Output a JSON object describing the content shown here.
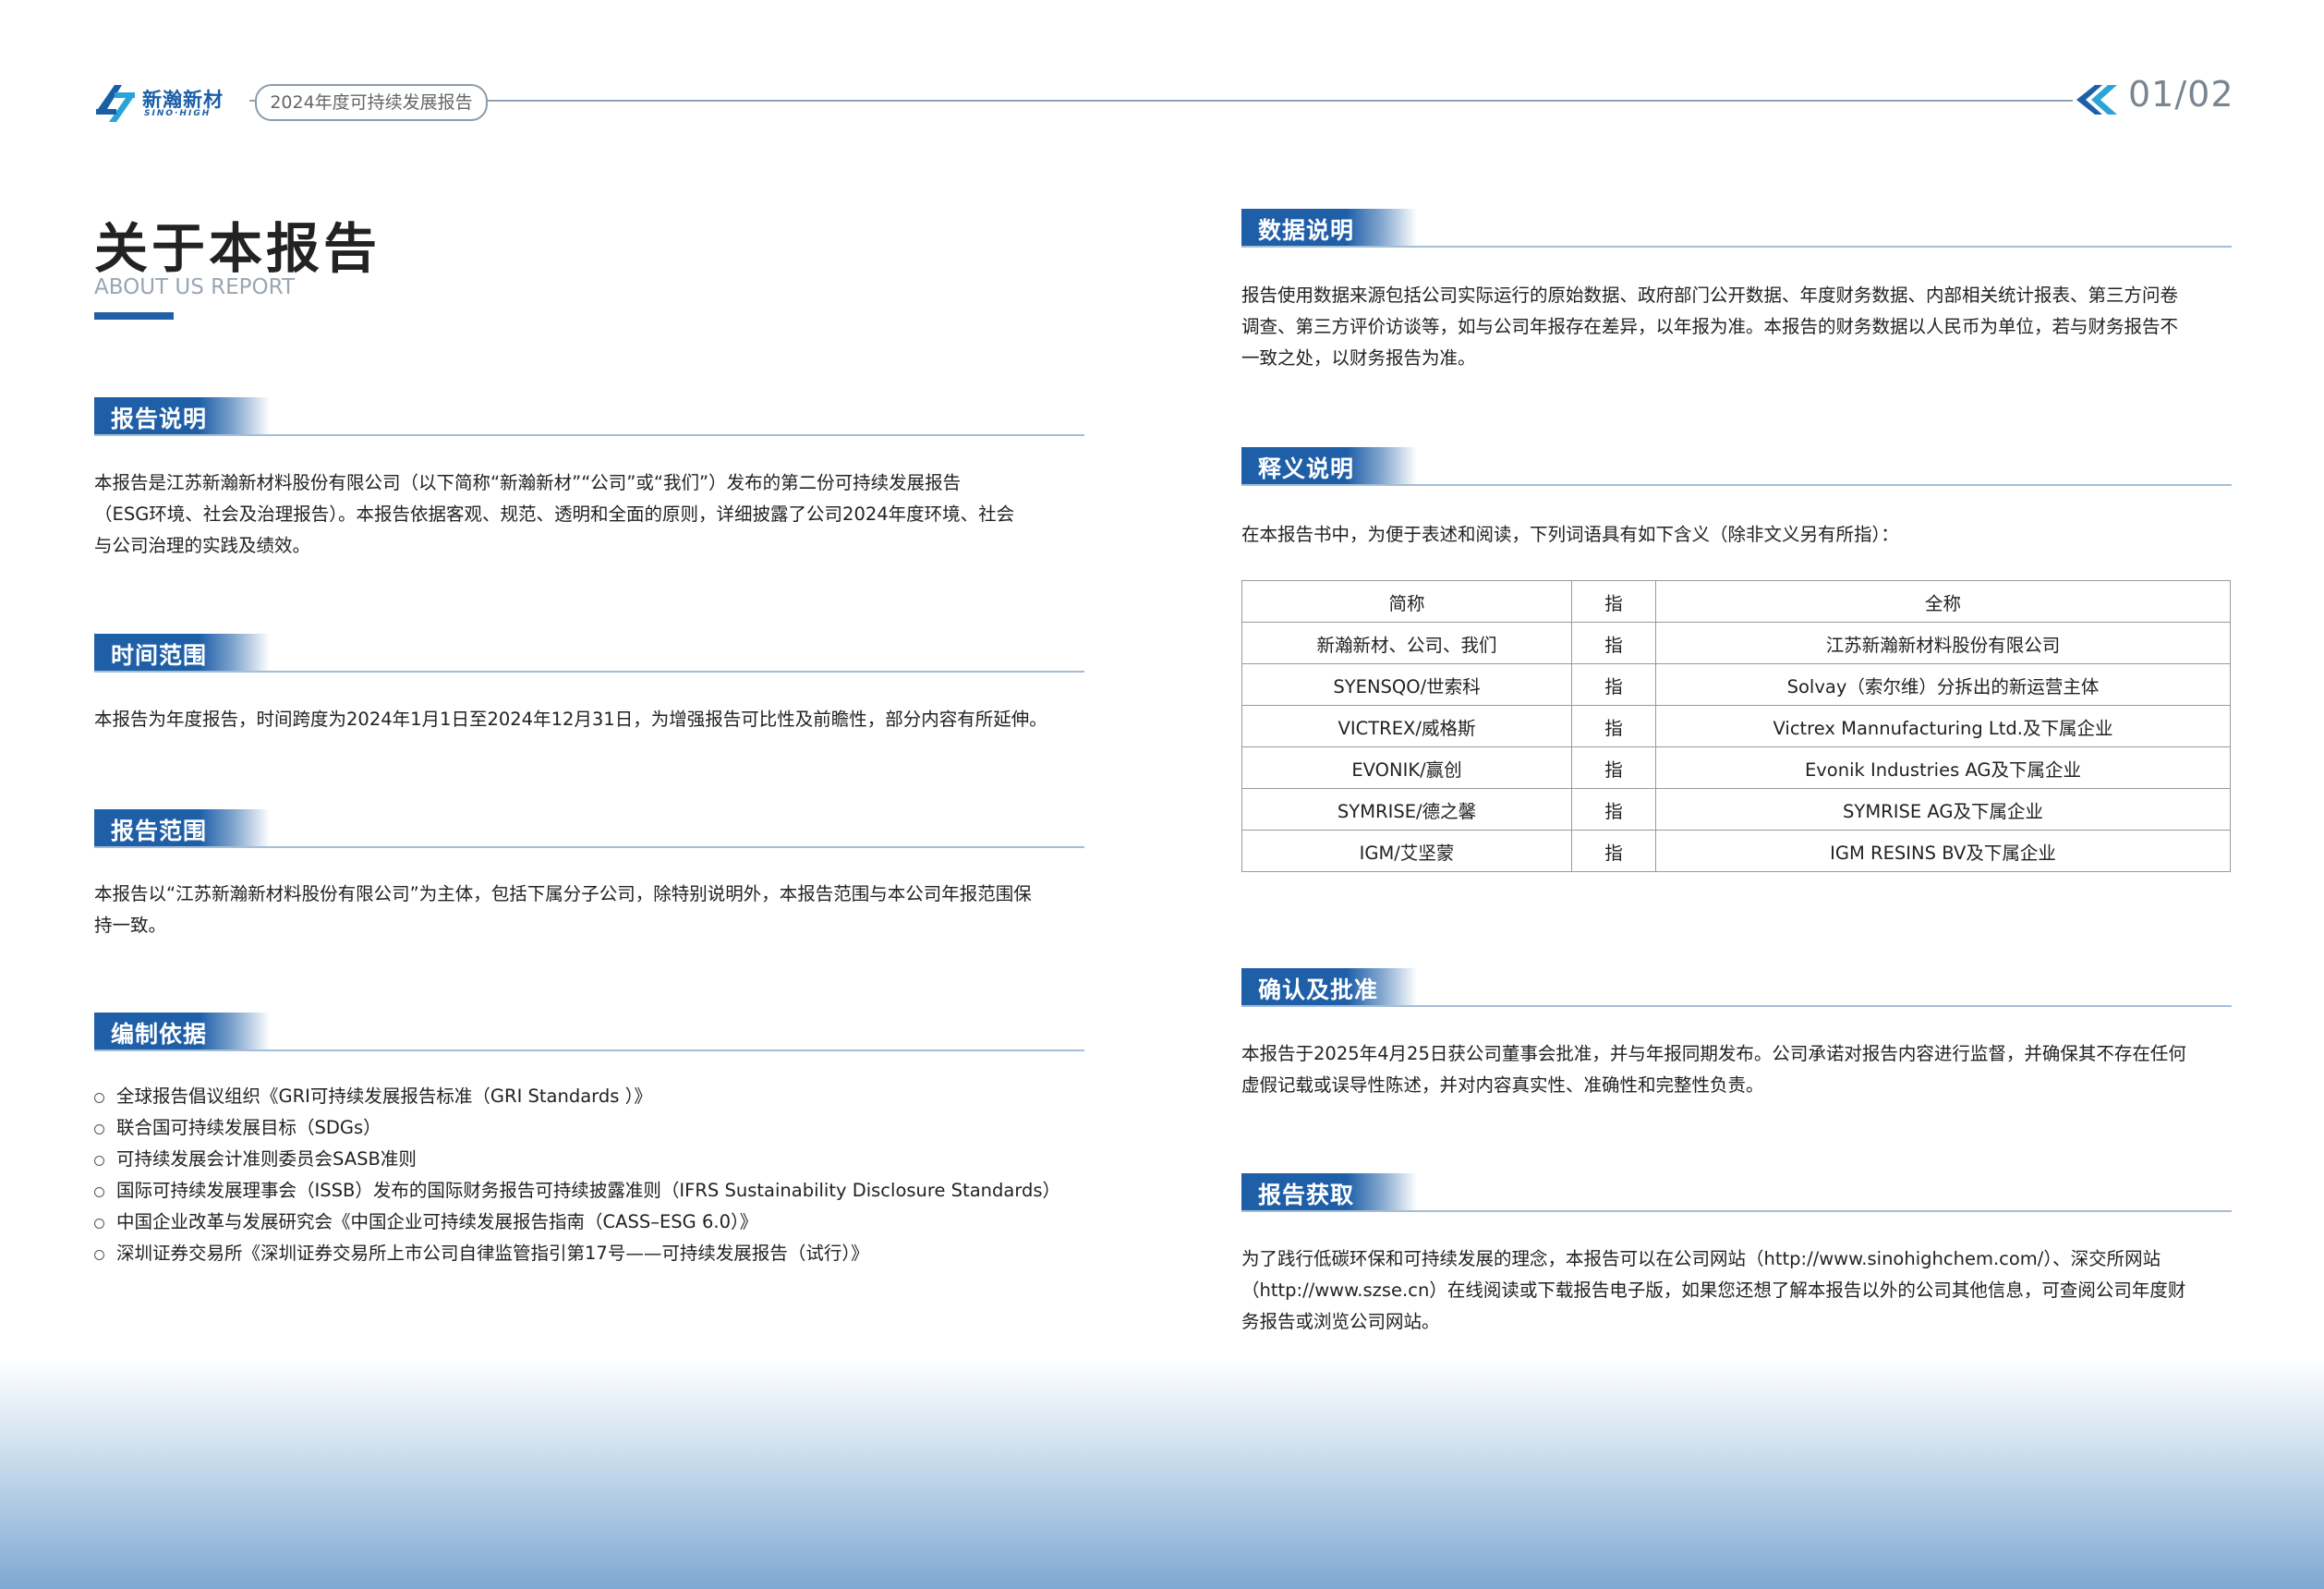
{
  "header": {
    "logo_cn": "新瀚新材",
    "logo_en": "SINO·HIGH",
    "report_name": "2024年度可持续发展报告",
    "page_number": "01/02",
    "accent_color": "#1f5fa8"
  },
  "title": {
    "main": "关于本报告",
    "sub": "ABOUT US REPORT"
  },
  "left": {
    "report_desc": {
      "heading": "报告说明",
      "lines": [
        "本报告是江苏新瀚新材料股份有限公司（以下简称“新瀚新材”“公司”或“我们”）发布的第二份可持续发展报告",
        "（ESG环境、社会及治理报告）。本报告依据客观、规范、透明和全面的原则，详细披露了公司2024年度环境、社会",
        "与公司治理的实践及绩效。"
      ]
    },
    "time_scope": {
      "heading": "时间范围",
      "lines": [
        "本报告为年度报告，时间跨度为2024年1月1日至2024年12月31日，为增强报告可比性及前瞻性，部分内容有所延伸。"
      ]
    },
    "report_scope": {
      "heading": "报告范围",
      "lines": [
        "本报告以“江苏新瀚新材料股份有限公司”为主体，包括下属分子公司，除特别说明外，本报告范围与本公司年报范围保",
        "持一致。"
      ]
    },
    "basis": {
      "heading": "编制依据",
      "items": [
        "全球报告倡议组织《GRI可持续发展报告标准（GRI Standards ）》",
        "联合国可持续发展目标（SDGs）",
        "可持续发展会计准则委员会SASB准则",
        "国际可持续发展理事会（ISSB）发布的国际财务报告可持续披露准则（IFRS Sustainability Disclosure Standards）",
        "中国企业改革与发展研究会《中国企业可持续发展报告指南（CASS–ESG 6.0）》",
        "深圳证券交易所《深圳证券交易所上市公司自律监管指引第17号——可持续发展报告（试行）》"
      ]
    }
  },
  "right": {
    "data_desc": {
      "heading": "数据说明",
      "lines": [
        "报告使用数据来源包括公司实际运行的原始数据、政府部门公开数据、年度财务数据、内部相关统计报表、第三方问卷",
        "调查、第三方评价访谈等，如与公司年报存在差异，以年报为准。本报告的财务数据以人民币为单位，若与财务报告不",
        "一致之处，以财务报告为准。"
      ]
    },
    "definitions": {
      "heading": "释义说明",
      "intro": "在本报告书中，为便于表述和阅读，下列词语具有如下含义（除非文义另有所指）：",
      "table": {
        "headers": [
          "简称",
          "指",
          "全称"
        ],
        "rows": [
          [
            "新瀚新材、公司、我们",
            "指",
            "江苏新瀚新材料股份有限公司"
          ],
          [
            "SYENSQO/世索科",
            "指",
            "Solvay（索尔维）分拆出的新运营主体"
          ],
          [
            "VICTREX/威格斯",
            "指",
            "Victrex Mannufacturing Ltd.及下属企业"
          ],
          [
            "EVONIK/赢创",
            "指",
            "Evonik Industries AG及下属企业"
          ],
          [
            "SYMRISE/德之馨",
            "指",
            "SYMRISE AG及下属企业"
          ],
          [
            "IGM/艾坚蒙",
            "指",
            "IGM RESINS BV及下属企业"
          ]
        ]
      }
    },
    "approval": {
      "heading": "确认及批准",
      "lines": [
        "本报告于2025年4月25日获公司董事会批准，并与年报同期发布。公司承诺对报告内容进行监督，并确保其不存在任何",
        "虚假记载或误导性陈述，并对内容真实性、准确性和完整性负责。"
      ]
    },
    "access": {
      "heading": "报告获取",
      "lines": [
        "为了践行低碳环保和可持续发展的理念，本报告可以在公司网站（http://www.sinohighchem.com/）、深交所网站",
        "（http://www.szse.cn）在线阅读或下载报告电子版，如果您还想了解本报告以外的公司其他信息，可查阅公司年度财",
        "务报告或浏览公司网站。"
      ]
    }
  }
}
